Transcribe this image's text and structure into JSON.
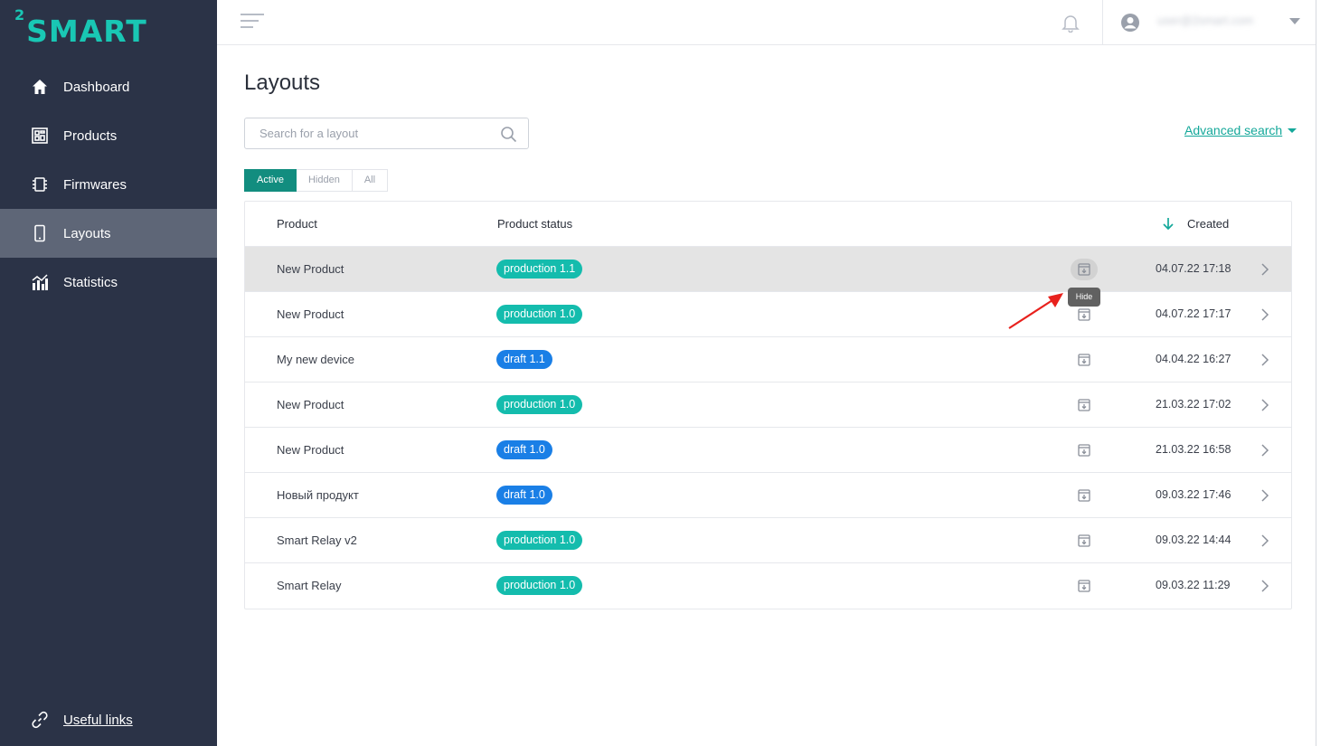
{
  "app": {
    "logo_text": "2SMART",
    "logo_sup": "2",
    "logo_main": "SMART",
    "brand_color": "#19c7b4"
  },
  "sidebar": {
    "items": [
      {
        "label": "Dashboard",
        "icon": "home-icon",
        "active": false
      },
      {
        "label": "Products",
        "icon": "products-icon",
        "active": false
      },
      {
        "label": "Firmwares",
        "icon": "chip-icon",
        "active": false
      },
      {
        "label": "Layouts",
        "icon": "phone-icon",
        "active": true
      },
      {
        "label": "Statistics",
        "icon": "chart-icon",
        "active": false
      }
    ],
    "useful_links": "Useful links"
  },
  "topbar": {
    "user_name": "user@2smart.com"
  },
  "page": {
    "title": "Layouts",
    "search_placeholder": "Search for a layout",
    "advanced_search": "Advanced search",
    "filter_tabs": [
      "Active",
      "Hidden",
      "All"
    ],
    "active_tab": "Active"
  },
  "table": {
    "headers": {
      "product": "Product",
      "status": "Product status",
      "created": "Created"
    },
    "rows": [
      {
        "product": "New Product",
        "status": "production 1.1",
        "status_type": "production",
        "created": "04.07.22 17:18"
      },
      {
        "product": "New Product",
        "status": "production 1.0",
        "status_type": "production",
        "created": "04.07.22 17:17"
      },
      {
        "product": "My new device",
        "status": "draft 1.1",
        "status_type": "draft",
        "created": "04.04.22 16:27"
      },
      {
        "product": "New Product",
        "status": "production 1.0",
        "status_type": "production",
        "created": "21.03.22 17:02"
      },
      {
        "product": "New Product",
        "status": "draft 1.0",
        "status_type": "draft",
        "created": "21.03.22 16:58"
      },
      {
        "product": "Новый продукт",
        "status": "draft 1.0",
        "status_type": "draft",
        "created": "09.03.22 17:46"
      },
      {
        "product": "Smart Relay v2",
        "status": "production 1.0",
        "status_type": "production",
        "created": "09.03.22 14:44"
      },
      {
        "product": "Smart Relay",
        "status": "production 1.0",
        "status_type": "production",
        "created": "09.03.22 11:29"
      }
    ]
  },
  "tooltip": {
    "text": "Hide"
  },
  "colors": {
    "sidebar_bg": "#2b3347",
    "active_nav": "#5e6677",
    "accent": "#128d7f",
    "production_badge": "#14bcad",
    "draft_badge": "#1a7fe6",
    "annotation_arrow": "#e8211d"
  }
}
